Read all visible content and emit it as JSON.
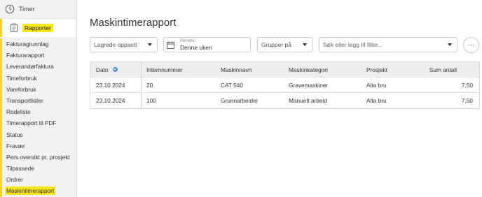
{
  "sidebar": {
    "timer_label": "Timer",
    "rapporter_label": "Rapporter",
    "items": [
      {
        "label": "Fakturagrunnlag"
      },
      {
        "label": "Fakturarapport"
      },
      {
        "label": "Leverandørfaktura"
      },
      {
        "label": "Timeforbruk"
      },
      {
        "label": "Vareforbruk"
      },
      {
        "label": "Transportlister"
      },
      {
        "label": "Rodeliste"
      },
      {
        "label": "Timerapport til PDF"
      },
      {
        "label": "Status"
      },
      {
        "label": "Fravær"
      },
      {
        "label": "Pers.oversikt pr. prosjekt"
      },
      {
        "label": "Tilpassede"
      },
      {
        "label": "Ordrer"
      },
      {
        "label": "Maskintimerapport"
      }
    ],
    "active_item": "Maskintimerapport"
  },
  "page": {
    "title": "Maskintimerapport"
  },
  "filters": {
    "saved_setup": "Lagrede oppsett",
    "period_label": "Periode:",
    "period_value": "Denne uken",
    "group_by": "Grupper på",
    "search_placeholder": "Søk eller legg til filter...",
    "more_label": "···"
  },
  "table": {
    "columns": [
      "Dato",
      "Internnummer",
      "Maskinnavn",
      "Maskinkategori",
      "Prosjekt",
      "Sum antall"
    ],
    "rows": [
      [
        "23.10.2024",
        "20",
        "CAT 540",
        "Gravemaskiner",
        "Alta bru",
        "7,50"
      ],
      [
        "23.10.2024",
        "100",
        "Grunnarbeider",
        "Manuelt arbeid",
        "Alta bru",
        "7,50"
      ]
    ]
  },
  "colors": {
    "highlight": "#f8e71c",
    "accent": "#4a90d9"
  }
}
